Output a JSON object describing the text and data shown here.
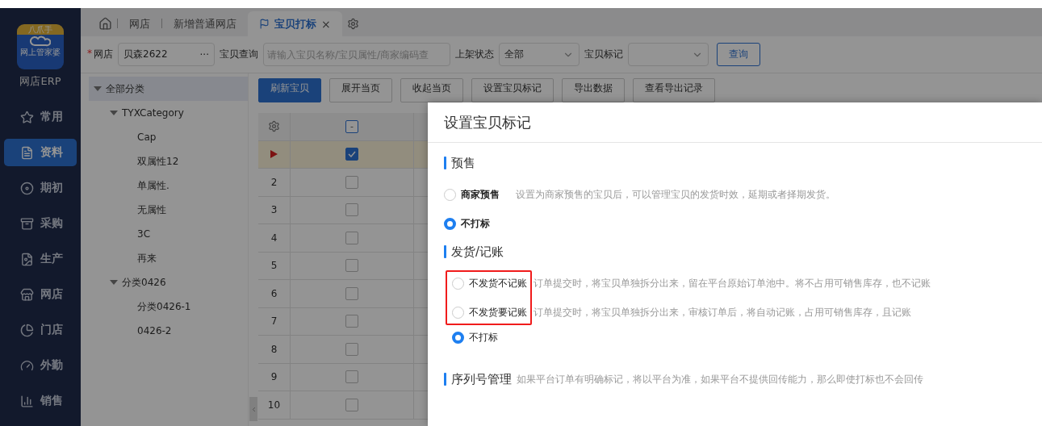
{
  "app": {
    "logo_badge": "八爪手",
    "logo_caption": "网上管家婆",
    "name": "网店ERP"
  },
  "nav": [
    {
      "label": "常用",
      "selected": false
    },
    {
      "label": "资料",
      "selected": true
    },
    {
      "label": "期初",
      "selected": false
    },
    {
      "label": "采购",
      "selected": false
    },
    {
      "label": "生产",
      "selected": false
    },
    {
      "label": "网店",
      "selected": false
    },
    {
      "label": "门店",
      "selected": false
    },
    {
      "label": "外勤",
      "selected": false
    },
    {
      "label": "销售",
      "selected": false
    }
  ],
  "tabs": [
    {
      "label": "网店",
      "selected": false,
      "closable": false,
      "flag": false
    },
    {
      "label": "新增普通网店",
      "selected": false,
      "closable": false,
      "flag": false
    },
    {
      "label": "宝贝打标",
      "selected": true,
      "closable": true,
      "flag": true
    }
  ],
  "close_glyph": "×",
  "filters": {
    "shop_label": "网店",
    "required_mark": "*",
    "shop_value": "贝森2622",
    "more_glyph": "···",
    "query_label": "宝贝查询",
    "query_placeholder": "请输入宝贝名称/宝贝属性/商家编码查",
    "status_label": "上架状态",
    "status_value": "全部",
    "mark_label": "宝贝标记",
    "search_button": "查询"
  },
  "tree": [
    {
      "label": "全部分类",
      "expanded": true,
      "selected": true,
      "children": [
        {
          "label": "TYXCategory",
          "expanded": true,
          "selected": false,
          "children": [
            {
              "label": "Cap",
              "selected": false
            },
            {
              "label": "双属性12",
              "selected": false
            },
            {
              "label": "单属性.",
              "selected": false
            },
            {
              "label": "无属性",
              "selected": false
            },
            {
              "label": "3C",
              "selected": false
            },
            {
              "label": "再来",
              "selected": false
            }
          ]
        },
        {
          "label": "分类0426",
          "expanded": true,
          "selected": false,
          "children": [
            {
              "label": "分类0426-1",
              "selected": false
            },
            {
              "label": "0426-2",
              "selected": false
            }
          ]
        }
      ]
    }
  ],
  "toolbar": [
    {
      "label": "刷新宝贝",
      "primary": true
    },
    {
      "label": "展开当页",
      "primary": false
    },
    {
      "label": "收起当页",
      "primary": false
    },
    {
      "label": "设置宝贝标记",
      "primary": false
    },
    {
      "label": "导出数据",
      "primary": false
    },
    {
      "label": "查看导出记录",
      "primary": false
    }
  ],
  "table": {
    "select_all_indeterminate": true,
    "indeterminate_glyph": "-",
    "rows": [
      {
        "current": true,
        "checked": true
      },
      {
        "current": false,
        "number": "2",
        "checked": false
      },
      {
        "current": false,
        "number": "3",
        "checked": false
      },
      {
        "current": false,
        "number": "4",
        "checked": false
      },
      {
        "current": false,
        "number": "5",
        "checked": false
      },
      {
        "current": false,
        "number": "6",
        "checked": false
      },
      {
        "current": false,
        "number": "7",
        "checked": false
      },
      {
        "current": false,
        "number": "8",
        "checked": false
      },
      {
        "current": false,
        "number": "9",
        "checked": false
      },
      {
        "current": false,
        "number": "10",
        "checked": false
      }
    ]
  },
  "dialog": {
    "title": "设置宝贝标记",
    "sections": [
      {
        "title": "预售",
        "options": [
          {
            "label": "商家预售",
            "description": "设置为商家预售的宝贝后，可以管理宝贝的发货时效，延期或者择期发货。",
            "selected": false,
            "bold": true,
            "boxed": false
          },
          {
            "label": "不打标",
            "selected": true,
            "bold": true,
            "boxed": false
          }
        ]
      },
      {
        "title": "发货/记账",
        "options": [
          {
            "label": "不发货不记账",
            "description": "订单提交时，将宝贝单独拆分出来，留在平台原始订单池中。将不占用可销售库存，也不记账",
            "selected": false,
            "bold": false,
            "boxed": true
          },
          {
            "label": "不发货要记账",
            "description": "订单提交时，将宝贝单独拆分出来，审核订单后，将自动记账，占用可销售库存，且记账",
            "selected": false,
            "bold": false,
            "boxed": true
          },
          {
            "label": "不打标",
            "selected": true,
            "bold": false,
            "boxed": false
          }
        ]
      },
      {
        "title": "序列号管理",
        "description": "如果平台订单有明确标记，将以平台为准，如果平台不提供回传能力，那么即使打标也不会回传"
      }
    ]
  }
}
